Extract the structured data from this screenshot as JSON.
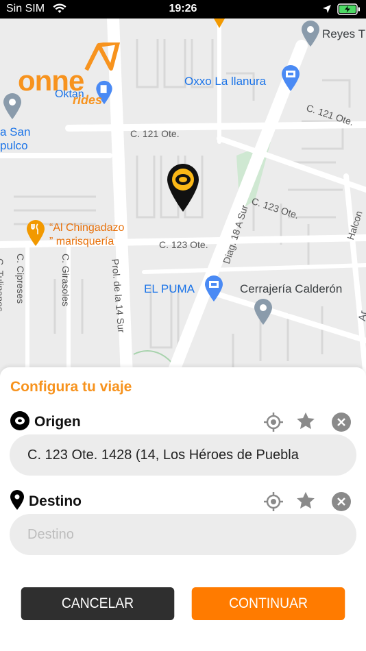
{
  "status_bar": {
    "carrier": "Sin SIM",
    "time": "19:26"
  },
  "logo": {
    "word": "onne",
    "sub": "rides"
  },
  "map": {
    "labels": {
      "reyes": "Reyes T",
      "oxxo": "Oxxo La llanura",
      "oktan": "Oktan",
      "c121_right": "C. 121 Ote.",
      "c121_left": "C. 121 Ote.",
      "san_a": "a San",
      "san_b": "pulco",
      "c123_right": "C. 123 Ote.",
      "c123_mid": "C. 123 Ote.",
      "diag": "Diag. 18 A Sur",
      "halcon": "Halcon",
      "chingadazo_1": "“Al Chingadazo",
      "chingadazo_2": "” marisquería",
      "cipreses": "C. Cipreses",
      "tulipanes": "C. Tulipanes",
      "girasoles": "C. Girasoles",
      "prol": "Prol. de la 14 Sur",
      "el_puma": "EL PUMA",
      "cerrajeria": "Cerrajería Calderón",
      "ar": "Ar"
    }
  },
  "sheet": {
    "title": "Configura tu viaje",
    "origin": {
      "label": "Origen",
      "value": "C. 123 Ote. 1428 (14, Los Héroes de Puebla"
    },
    "destination": {
      "label": "Destino",
      "placeholder": "Destino"
    }
  },
  "buttons": {
    "cancel": "CANCELAR",
    "continue": "CONTINUAR"
  },
  "colors": {
    "brand_orange": "#f7931e",
    "button_orange": "#ff7b00",
    "button_dark": "#2f2f2f",
    "poi_blue": "#1a73e8"
  }
}
